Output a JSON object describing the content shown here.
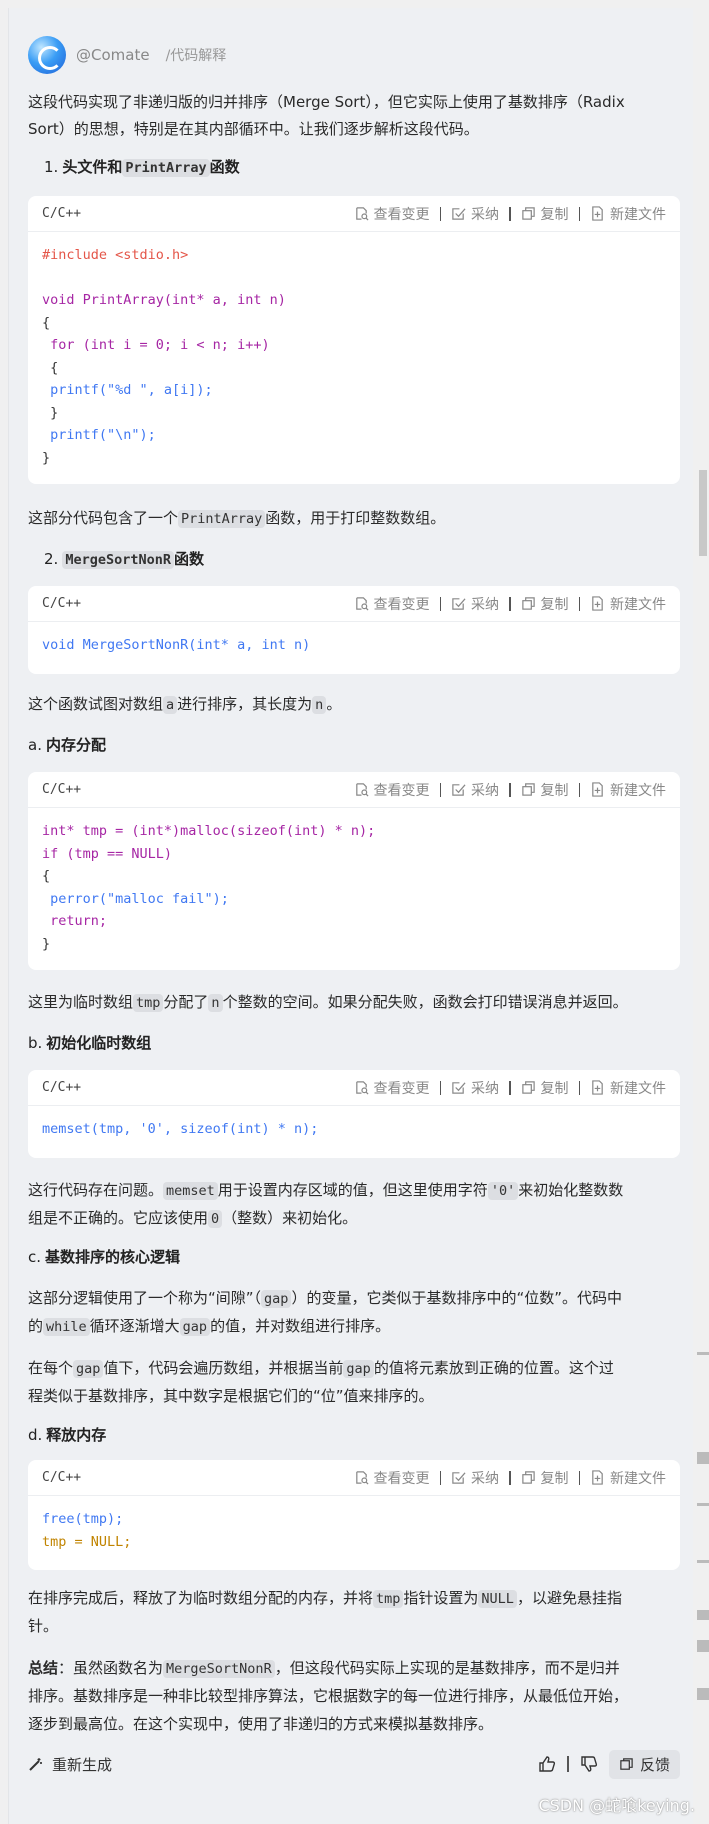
{
  "header": {
    "handle": "@Comate",
    "command": "/代码解释"
  },
  "intro": [
    "这段代码实现了非递归版的归并排序（Merge Sort），但它实际上使用了基数排序（Radix",
    "Sort）的思想，特别是在其内部循环中。让我们逐步解析这段代码。"
  ],
  "toolbar": {
    "view_changes": "查看变更",
    "accept": "采纳",
    "copy": "复制",
    "new_file": "新建文件"
  },
  "sections": {
    "s1": {
      "num": "1.",
      "pre": "头文件和",
      "code": "PrintArray",
      "post": "函数"
    },
    "s1_after": {
      "pre": "这部分代码包含了一个",
      "code": "PrintArray",
      "post": "函数，用于打印整数数组。"
    },
    "s2": {
      "num": "2.",
      "code": "MergeSortNonR",
      "post": "函数"
    },
    "s2_after": {
      "pre": "这个函数试图对数组",
      "code1": "a",
      "mid": "进行排序，其长度为",
      "code2": "n",
      "post": "。"
    },
    "a": {
      "num": "a.",
      "title": "内存分配"
    },
    "a_after": {
      "pre": "这里为临时数组",
      "code1": "tmp",
      "mid": "分配了",
      "code2": "n",
      "post": "个整数的空间。如果分配失败，函数会打印错误消息并返回。"
    },
    "b": {
      "num": "b.",
      "title": "初始化临时数组"
    },
    "b_after": {
      "l1_pre": "这行代码存在问题。",
      "l1_code1": "memset",
      "l1_mid": "用于设置内存区域的值，但这里使用字符",
      "l1_code2": "'0'",
      "l1_post": "来初始化整数数",
      "l2_pre": "组是不正确的。它应该使用",
      "l2_code": "0",
      "l2_post": "（整数）来初始化。"
    },
    "c": {
      "num": "c.",
      "title": "基数排序的核心逻辑"
    },
    "c_p1": {
      "l1_pre": "这部分逻辑使用了一个称为“间隙”（",
      "l1_code": "gap",
      "l1_post": "）的变量，它类似于基数排序中的“位数”。代码中",
      "l2_pre": "的",
      "l2_code1": "while",
      "l2_mid": "循环逐渐增大",
      "l2_code2": "gap",
      "l2_post": "的值，并对数组进行排序。"
    },
    "c_p2": {
      "l1_pre": "在每个",
      "l1_code1": "gap",
      "l1_mid": "值下，代码会遍历数组，并根据当前",
      "l1_code2": "gap",
      "l1_post": "的值将元素放到正确的位置。这个过",
      "l2": "程类似于基数排序，其中数字是根据它们的“位”值来排序的。"
    },
    "d": {
      "num": "d.",
      "title": "释放内存"
    },
    "d_after": {
      "l1_pre": "在排序完成后，释放了为临时数组分配的内存，并将",
      "l1_code1": "tmp",
      "l1_mid": "指针设置为",
      "l1_code2": "NULL",
      "l1_post": "，以避免悬挂指",
      "l2": "针。"
    },
    "summary": {
      "label": "总结",
      "l1_pre": "：虽然函数名为",
      "l1_code": "MergeSortNonR",
      "l1_post": "，但这段代码实际上实现的是基数排序，而不是归并",
      "l2": "排序。基数排序是一种非比较型排序算法，它根据数字的每一位进行排序，从最低位开始，",
      "l3": "逐步到最高位。在这个实现中，使用了非递归的方式来模拟基数排序。"
    }
  },
  "code_blocks": {
    "lang": "C/C++",
    "b1": [
      "#include <stdio.h>",
      "",
      "void PrintArray(int* a, int n)",
      "{",
      " for (int i = 0; i < n; i++)",
      " {",
      " printf(\"%d \", a[i]);",
      " }",
      " printf(\"\\n\");",
      "}"
    ],
    "b2": [
      "void MergeSortNonR(int* a, int n)"
    ],
    "b3": [
      "int* tmp = (int*)malloc(sizeof(int) * n);",
      "if (tmp == NULL)",
      "{",
      " perror(\"malloc fail\");",
      " return;",
      "}"
    ],
    "b4": [
      "memset(tmp, '0', sizeof(int) * n);"
    ],
    "b5": [
      "free(tmp);",
      "tmp = NULL;"
    ]
  },
  "footer": {
    "regenerate": "重新生成",
    "feedback": "反馈"
  },
  "watermark": "CSDN @蛇喰keying."
}
